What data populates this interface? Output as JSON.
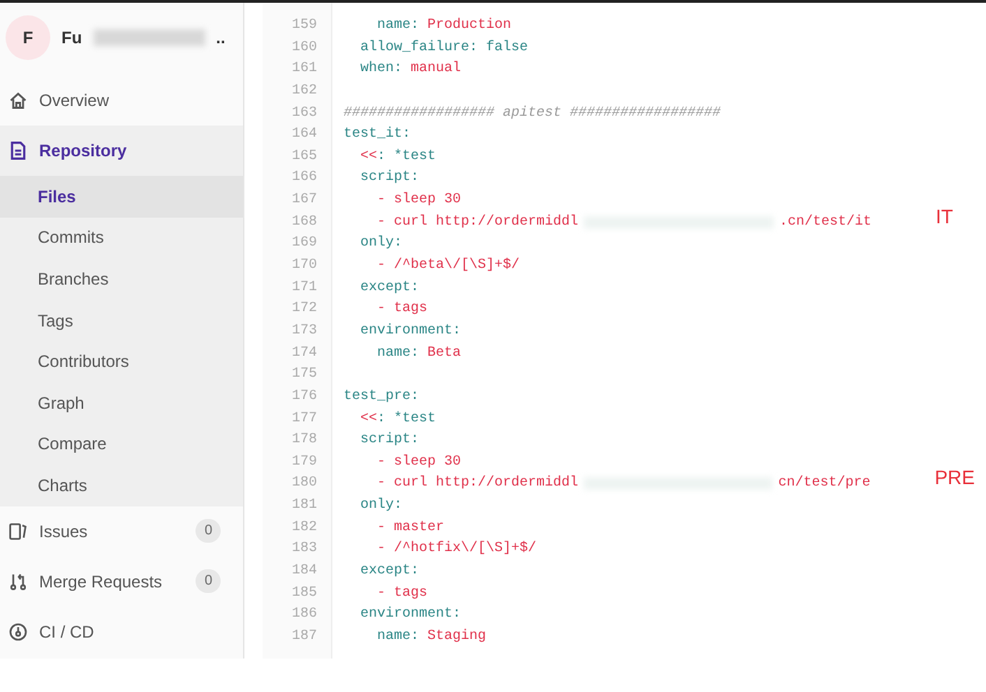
{
  "sidebar": {
    "avatar": "F",
    "project_name_start": "Fu",
    "project_name_end": "..",
    "items": [
      {
        "label": "Overview",
        "kind": "home",
        "selected": false
      },
      {
        "label": "Repository",
        "kind": "file",
        "selected": true,
        "children": [
          {
            "label": "Files",
            "selected": true
          },
          {
            "label": "Commits",
            "selected": false
          },
          {
            "label": "Branches",
            "selected": false
          },
          {
            "label": "Tags",
            "selected": false
          },
          {
            "label": "Contributors",
            "selected": false
          },
          {
            "label": "Graph",
            "selected": false
          },
          {
            "label": "Compare",
            "selected": false
          },
          {
            "label": "Charts",
            "selected": false
          }
        ]
      },
      {
        "label": "Issues",
        "kind": "issues",
        "selected": false,
        "count": "0"
      },
      {
        "label": "Merge Requests",
        "kind": "merge",
        "selected": false,
        "count": "0"
      },
      {
        "label": "CI / CD",
        "kind": "cicd",
        "selected": false
      }
    ]
  },
  "code": {
    "lines": [
      {
        "n": "159",
        "tokens": [
          {
            "kind": "key",
            "t": "    name:"
          },
          {
            "kind": "value",
            "t": " Production"
          }
        ]
      },
      {
        "n": "160",
        "tokens": [
          {
            "kind": "key",
            "t": "  allow_failure: false"
          }
        ]
      },
      {
        "n": "161",
        "tokens": [
          {
            "kind": "key",
            "t": "  when:"
          },
          {
            "kind": "value",
            "t": " manual"
          }
        ]
      },
      {
        "n": "162"
      },
      {
        "n": "163",
        "tokens": [
          {
            "kind": "comment",
            "t": "################## apitest ##################"
          }
        ]
      },
      {
        "n": "164",
        "tokens": [
          {
            "kind": "key",
            "t": "test_it:"
          }
        ]
      },
      {
        "n": "165",
        "tokens": [
          {
            "kind": "value",
            "t": "  <<"
          },
          {
            "kind": "key",
            "t": ": *test"
          }
        ]
      },
      {
        "n": "166",
        "tokens": [
          {
            "kind": "key",
            "t": "  script:"
          }
        ]
      },
      {
        "n": "167",
        "tokens": [
          {
            "kind": "value",
            "t": "    - sleep 30"
          }
        ]
      },
      {
        "n": "168",
        "tokens": [
          {
            "kind": "value",
            "t": "    - curl http://ordermiddl"
          },
          {
            "kind": "value",
            "t": ".cn/test/it"
          }
        ],
        "redacted": true,
        "annotation": "IT"
      },
      {
        "n": "169",
        "tokens": [
          {
            "kind": "key",
            "t": "  only:"
          }
        ]
      },
      {
        "n": "170",
        "tokens": [
          {
            "kind": "value",
            "t": "    - /^beta\\/[\\S]+$/"
          }
        ]
      },
      {
        "n": "171",
        "tokens": [
          {
            "kind": "key",
            "t": "  except:"
          }
        ]
      },
      {
        "n": "172",
        "tokens": [
          {
            "kind": "value",
            "t": "    - tags"
          }
        ]
      },
      {
        "n": "173",
        "tokens": [
          {
            "kind": "key",
            "t": "  environment:"
          }
        ]
      },
      {
        "n": "174",
        "tokens": [
          {
            "kind": "key",
            "t": "    name:"
          },
          {
            "kind": "value",
            "t": " Beta"
          }
        ]
      },
      {
        "n": "175"
      },
      {
        "n": "176",
        "tokens": [
          {
            "kind": "key",
            "t": "test_pre:"
          }
        ]
      },
      {
        "n": "177",
        "tokens": [
          {
            "kind": "value",
            "t": "  <<"
          },
          {
            "kind": "key",
            "t": ": *test"
          }
        ]
      },
      {
        "n": "178",
        "tokens": [
          {
            "kind": "key",
            "t": "  script:"
          }
        ]
      },
      {
        "n": "179",
        "tokens": [
          {
            "kind": "value",
            "t": "    - sleep 30"
          }
        ]
      },
      {
        "n": "180",
        "tokens": [
          {
            "kind": "value",
            "t": "    - curl http://ordermiddl"
          },
          {
            "kind": "value",
            "t": "cn/test/pre"
          }
        ],
        "redacted": true,
        "annotation": "PRE"
      },
      {
        "n": "181",
        "tokens": [
          {
            "kind": "key",
            "t": "  only:"
          }
        ]
      },
      {
        "n": "182",
        "tokens": [
          {
            "kind": "value",
            "t": "    - master"
          }
        ]
      },
      {
        "n": "183",
        "tokens": [
          {
            "kind": "value",
            "t": "    - /^hotfix\\/[\\S]+$/"
          }
        ]
      },
      {
        "n": "184",
        "tokens": [
          {
            "kind": "key",
            "t": "  except:"
          }
        ]
      },
      {
        "n": "185",
        "tokens": [
          {
            "kind": "value",
            "t": "    - tags"
          }
        ]
      },
      {
        "n": "186",
        "tokens": [
          {
            "kind": "key",
            "t": "  environment:"
          }
        ]
      },
      {
        "n": "187",
        "tokens": [
          {
            "kind": "key",
            "t": "    name:"
          },
          {
            "kind": "value",
            "t": " Staging"
          }
        ]
      }
    ]
  }
}
